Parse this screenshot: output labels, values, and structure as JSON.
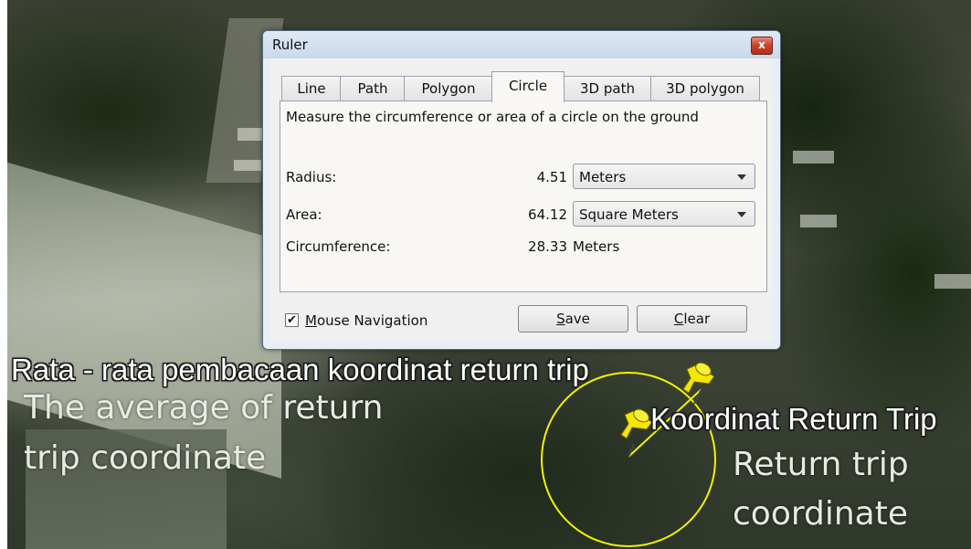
{
  "ruler": {
    "title": "Ruler",
    "close_glyph": "x",
    "tabs": [
      {
        "label": "Line",
        "active": false
      },
      {
        "label": "Path",
        "active": false
      },
      {
        "label": "Polygon",
        "active": false
      },
      {
        "label": "Circle",
        "active": true
      },
      {
        "label": "3D path",
        "active": false
      },
      {
        "label": "3D polygon",
        "active": false
      }
    ],
    "description": "Measure the circumference or area of a circle on the ground",
    "radius": {
      "label": "Radius:",
      "value": "4.51",
      "unit": "Meters"
    },
    "area": {
      "label": "Area:",
      "value": "64.12",
      "unit": "Square Meters"
    },
    "circumference": {
      "label": "Circumference:",
      "value": "28.33",
      "unit": "Meters"
    },
    "mouse_navigation": {
      "label_first": "M",
      "label_rest": "ouse Navigation",
      "checked": true,
      "check_glyph": "✔"
    },
    "save_button": {
      "underlined": "S",
      "rest": "ave"
    },
    "clear_button": {
      "underlined": "C",
      "rest": "lear"
    }
  },
  "annotations": {
    "rata_rata": "Rata - rata pembacaan koordinat return trip",
    "average_line1": "The average of return",
    "average_line2": "trip coordinate",
    "koordinat_return_trip": "Koordinat Return Trip",
    "return_trip_line1": "Return trip",
    "return_trip_line2": "coordinate"
  },
  "colors": {
    "circle": "#f2f200",
    "pin": "#f4e600"
  },
  "icons": [
    "pushpin-icon",
    "pushpin-icon",
    "close-icon",
    "chevron-down-icon",
    "checkmark-icon"
  ]
}
